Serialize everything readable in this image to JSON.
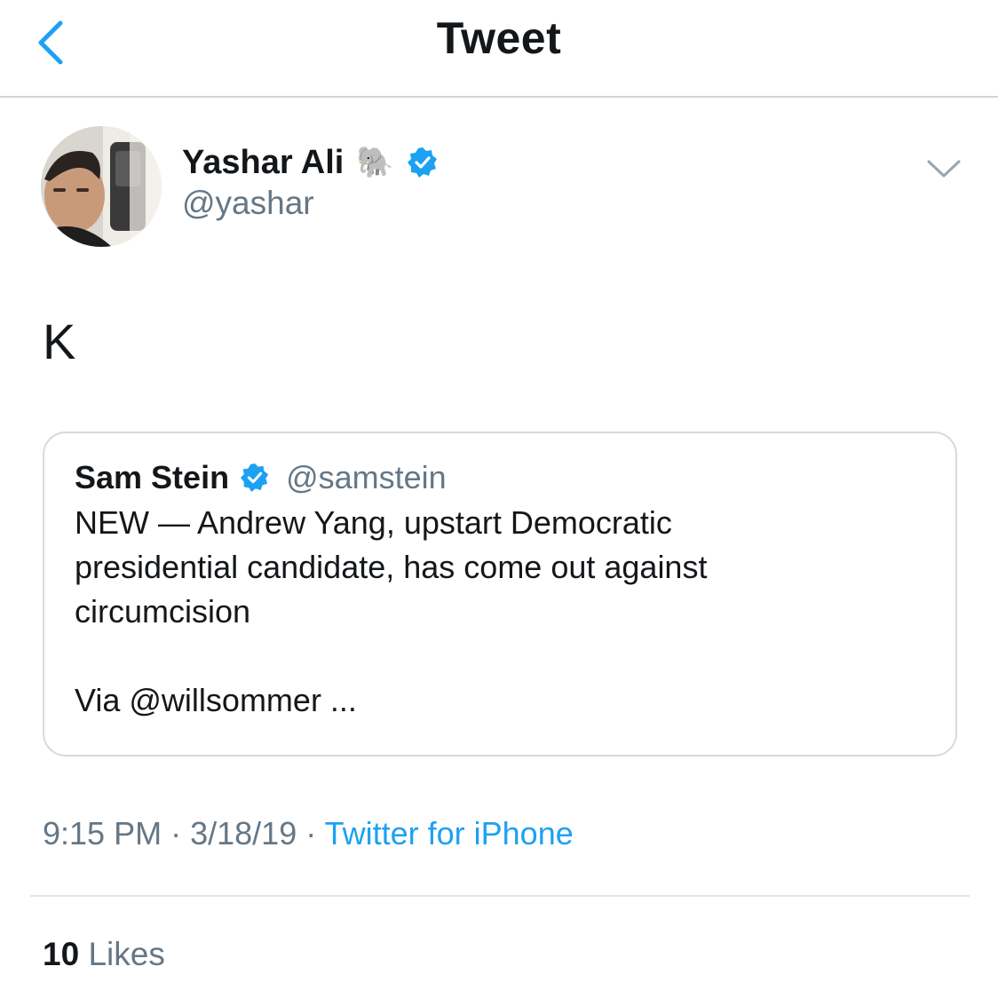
{
  "header": {
    "title": "Tweet"
  },
  "tweet": {
    "author": {
      "name": "Yashar Ali",
      "emoji": "🐘",
      "handle": "@yashar",
      "verified": true
    },
    "text": "K",
    "quoted": {
      "author": {
        "name": "Sam Stein",
        "handle": "@samstein",
        "verified": true
      },
      "line1": "NEW — Andrew Yang, upstart Democratic",
      "line2": "presidential candidate, has come out against",
      "line3": "circumcision",
      "line4": "Via @willsommer ..."
    },
    "time": "9:15 PM",
    "separator": "·",
    "date": "3/18/19",
    "source": "Twitter for iPhone",
    "likes_count": "10",
    "likes_label": "Likes"
  },
  "colors": {
    "accent": "#1da1f2",
    "secondary_text": "#657786",
    "primary_text": "#14171a",
    "border": "#d6dadd"
  }
}
